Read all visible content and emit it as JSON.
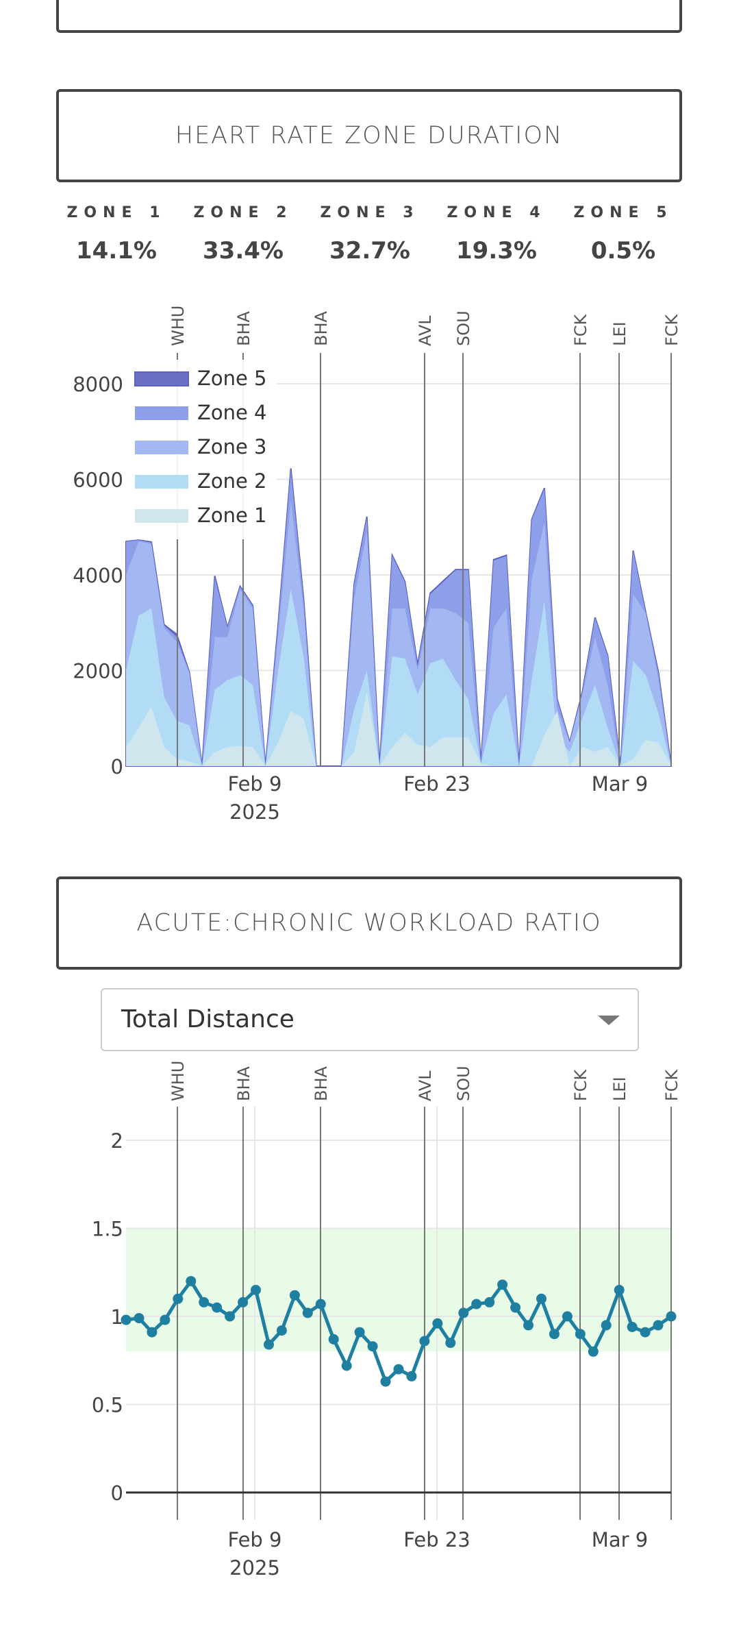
{
  "hr_section": {
    "title": "HEART RATE ZONE DURATION",
    "zones": [
      {
        "label": "ZONE 1",
        "pct": "14.1%"
      },
      {
        "label": "ZONE 2",
        "pct": "33.4%"
      },
      {
        "label": "ZONE 3",
        "pct": "32.7%"
      },
      {
        "label": "ZONE 4",
        "pct": "19.3%"
      },
      {
        "label": "ZONE 5",
        "pct": "0.5%"
      }
    ]
  },
  "acwr_section": {
    "title": "ACUTE:CHRONIC WORKLOAD RATIO",
    "metric_select": {
      "value": "Total Distance"
    }
  },
  "chart_data": [
    {
      "type": "area",
      "stacked": true,
      "x_axis_ticks": [
        "Feb 9",
        "Feb 23",
        "Mar 9"
      ],
      "x_axis_year": "2025",
      "y_ticks": [
        0,
        2000,
        4000,
        6000,
        8000
      ],
      "ylim": [
        0,
        8800
      ],
      "legend_position": "top-left",
      "match_markers": [
        "WHU",
        "BHA",
        "BHA",
        "AVL",
        "SOU",
        "FCK",
        "LEI",
        "FCK"
      ],
      "colors": {
        "Zone 1": "#cfe6ee",
        "Zone 2": "#b2dcf6",
        "Zone 3": "#a3b7f2",
        "Zone 4": "#8c9fe8",
        "Zone 5": "#6b6fc4"
      },
      "series_cumulative": [
        {
          "name": "Zone 1",
          "values": [
            400,
            800,
            1250,
            400,
            150,
            100,
            0,
            300,
            400,
            420,
            400,
            0,
            500,
            1150,
            1000,
            0,
            0,
            0,
            300,
            1550,
            0,
            400,
            700,
            450,
            400,
            600,
            600,
            600,
            50,
            0,
            0,
            0,
            0,
            650,
            1150,
            0,
            400,
            300,
            400,
            0,
            150,
            550,
            500,
            0
          ]
        },
        {
          "name": "Zone 2",
          "values": [
            2000,
            3150,
            3300,
            1450,
            950,
            850,
            0,
            1600,
            1800,
            1900,
            1700,
            0,
            2000,
            3700,
            2300,
            0,
            0,
            0,
            1200,
            2000,
            0,
            2300,
            2250,
            1500,
            2150,
            2250,
            1800,
            1400,
            50,
            1100,
            1500,
            0,
            1800,
            3450,
            600,
            300,
            1000,
            1700,
            800,
            0,
            2200,
            1900,
            1100,
            0
          ]
        },
        {
          "name": "Zone 3",
          "values": [
            4000,
            4700,
            4650,
            2900,
            2600,
            1950,
            0,
            2700,
            2700,
            3700,
            3300,
            0,
            2700,
            5550,
            3300,
            0,
            0,
            0,
            3500,
            4900,
            0,
            3300,
            3300,
            2000,
            3300,
            3300,
            3200,
            3000,
            50,
            2900,
            3300,
            0,
            3900,
            5100,
            1200,
            500,
            1500,
            2700,
            1700,
            0,
            3600,
            3200,
            1800,
            0
          ]
        },
        {
          "name": "Zone 4",
          "values": [
            4700,
            4730,
            4680,
            2950,
            2700,
            1960,
            0,
            3950,
            2900,
            3750,
            3350,
            0,
            2950,
            6200,
            3500,
            0,
            0,
            0,
            3800,
            5200,
            0,
            4400,
            3850,
            2100,
            3600,
            3850,
            4100,
            4100,
            60,
            4300,
            4400,
            0,
            5150,
            5800,
            1400,
            500,
            1550,
            3100,
            2300,
            0,
            4500,
            3200,
            1950,
            0
          ]
        },
        {
          "name": "Zone 5",
          "values": [
            4700,
            4730,
            4690,
            2960,
            2760,
            1960,
            0,
            3980,
            2900,
            3760,
            3360,
            0,
            2960,
            6230,
            3520,
            0,
            0,
            0,
            3820,
            5220,
            0,
            4410,
            3860,
            2120,
            3620,
            3870,
            4110,
            4110,
            60,
            4320,
            4410,
            0,
            5160,
            5820,
            1410,
            500,
            1560,
            3110,
            2310,
            0,
            4510,
            3210,
            1960,
            0
          ]
        }
      ]
    },
    {
      "type": "line",
      "x_axis_ticks": [
        "Feb 9",
        "Feb 23",
        "Mar 9"
      ],
      "x_axis_year": "2025",
      "y_ticks": [
        "0",
        "0.5",
        "1",
        "1.5",
        "2"
      ],
      "ylim": [
        -0.08,
        2.2
      ],
      "target_band": [
        0.8,
        1.5
      ],
      "match_markers": [
        "WHU",
        "BHA",
        "BHA",
        "AVL",
        "SOU",
        "FCK",
        "LEI",
        "FCK"
      ],
      "series": [
        {
          "values": [
            0.98,
            0.99,
            0.91,
            0.98,
            1.1,
            1.2,
            1.08,
            1.05,
            1.0,
            1.08,
            1.15,
            0.84,
            0.92,
            1.12,
            1.02,
            1.07,
            0.87,
            0.72,
            0.91,
            0.83,
            0.63,
            0.7,
            0.66,
            0.86,
            0.96,
            0.85,
            1.02,
            1.07,
            1.08,
            1.18,
            1.05,
            0.95,
            1.1,
            0.9,
            1.0,
            0.9,
            0.8,
            0.95,
            1.15,
            0.94,
            0.91,
            0.95,
            1.0
          ]
        }
      ]
    }
  ]
}
